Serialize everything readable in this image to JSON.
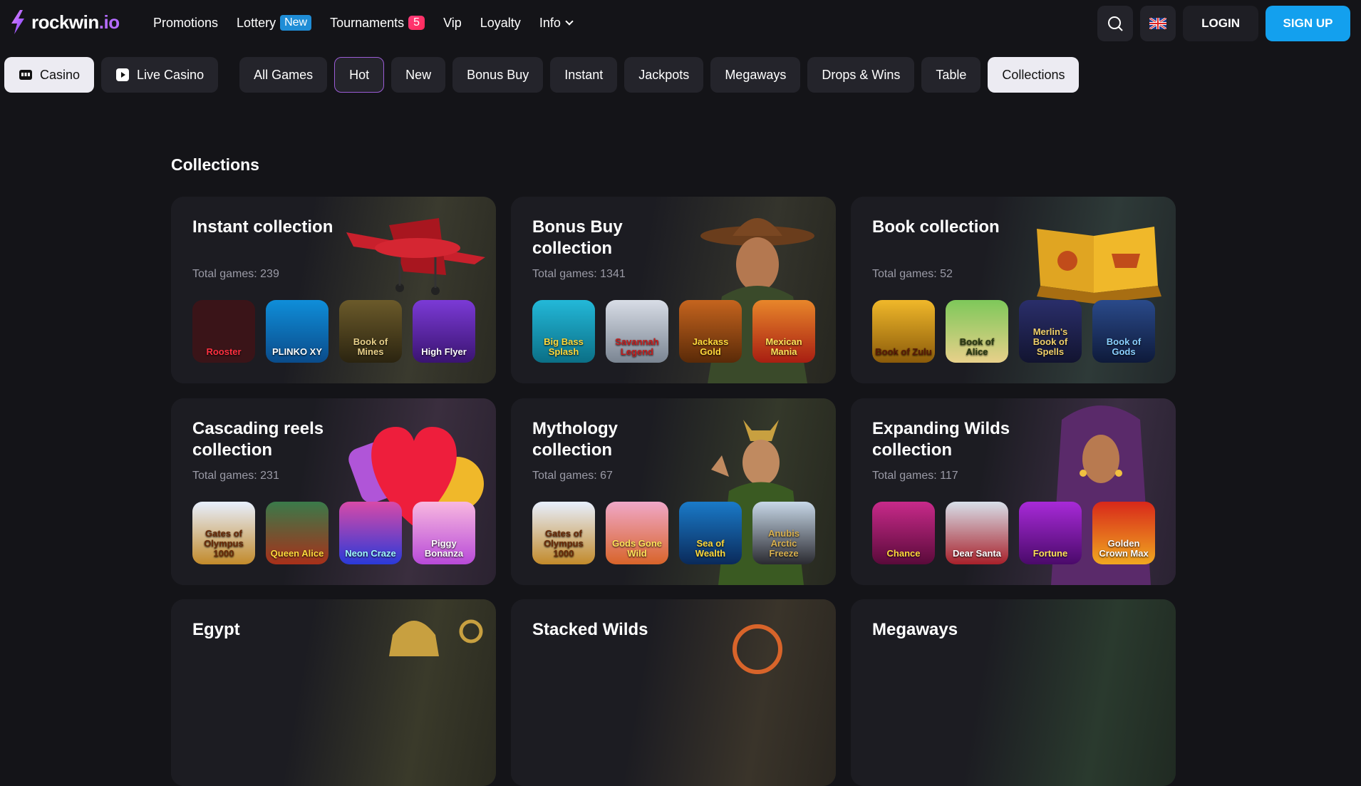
{
  "brand": {
    "name": "rockwin",
    "tld": ".io"
  },
  "nav": [
    {
      "label": "Promotions"
    },
    {
      "label": "Lottery",
      "badge": "New"
    },
    {
      "label": "Tournaments",
      "count": "5"
    },
    {
      "label": "Vip"
    },
    {
      "label": "Loyalty"
    },
    {
      "label": "Info"
    }
  ],
  "header": {
    "login_label": "LOGIN",
    "signup_label": "SIGN UP"
  },
  "categories": {
    "casino": "Casino",
    "live_casino": "Live Casino",
    "tabs": [
      "All Games",
      "Hot",
      "New",
      "Bonus Buy",
      "Instant",
      "Jackpots",
      "Megaways",
      "Drops & Wins",
      "Table",
      "Collections"
    ]
  },
  "section": {
    "title": "Collections"
  },
  "collections": [
    {
      "title": "Instant collection",
      "count": "Total games: 239",
      "games": [
        "Rooster",
        "PLINKO XY",
        "Book of Mines",
        "High Flyer"
      ]
    },
    {
      "title": "Bonus Buy collection",
      "count": "Total games: 1341",
      "games": [
        "Big Bass Splash",
        "Savannah Legend",
        "Jackass Gold",
        "Mexican Mania"
      ]
    },
    {
      "title": "Book collection",
      "count": "Total games: 52",
      "games": [
        "Book of Zulu",
        "Book of Alice",
        "Merlin's Book of Spells",
        "Book of Gods"
      ]
    },
    {
      "title": "Cascading reels collection",
      "count": "Total games: 231",
      "games": [
        "Gates of Olympus 1000",
        "Queen Alice",
        "Neon Craze",
        "Piggy Bonanza"
      ]
    },
    {
      "title": "Mythology collection",
      "count": "Total games: 67",
      "games": [
        "Gates of Olympus 1000",
        "Gods Gone Wild",
        "Sea of Wealth",
        "Anubis Arctic Freeze"
      ]
    },
    {
      "title": "Expanding Wilds collection",
      "count": "Total games: 117",
      "games": [
        "Chance",
        "Dear Santa",
        "Fortune",
        "Golden Crown Max"
      ]
    },
    {
      "title": "Egypt",
      "count": "",
      "games": []
    },
    {
      "title": "Stacked Wilds",
      "count": "",
      "games": []
    },
    {
      "title": "Megaways",
      "count": "",
      "games": []
    }
  ],
  "colors": {
    "accent": "#13a0ee",
    "hot_border": "#9b5cd6",
    "badge_new": "#1f8dd6",
    "badge_count": "#ff2a5a"
  }
}
